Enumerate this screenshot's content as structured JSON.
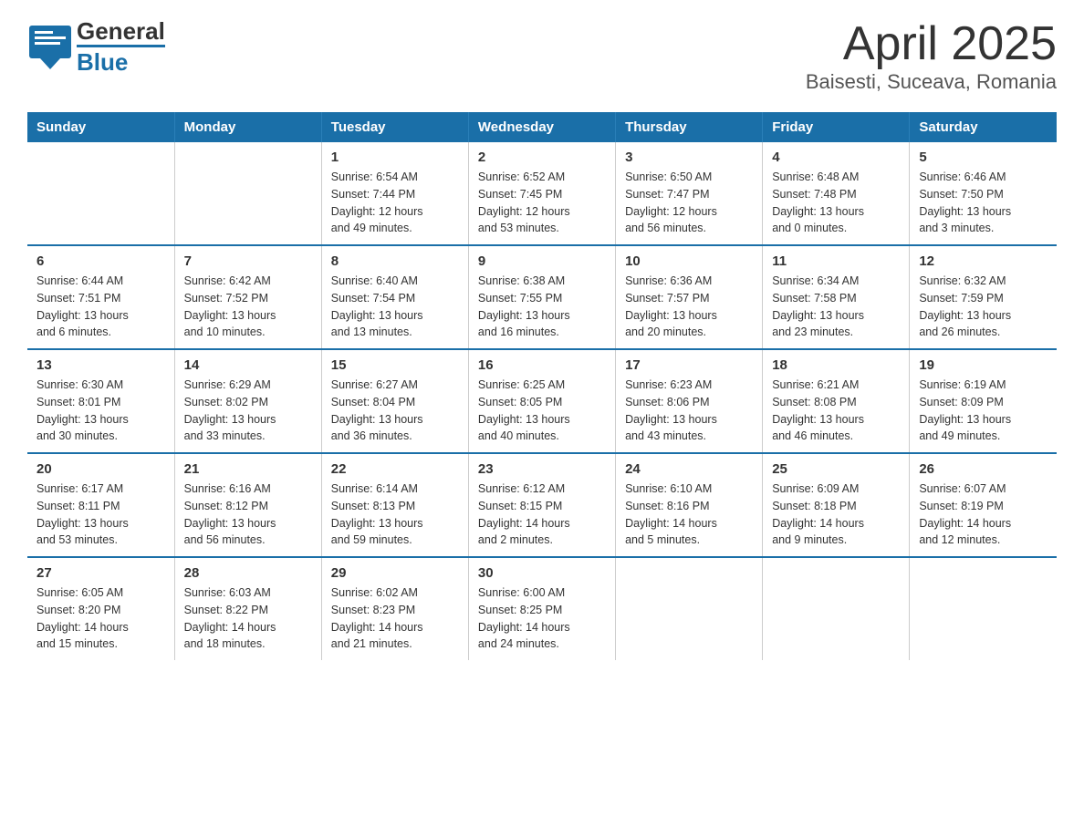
{
  "logo": {
    "text_general": "General",
    "text_blue": "Blue"
  },
  "title": "April 2025",
  "subtitle": "Baisesti, Suceava, Romania",
  "days_of_week": [
    "Sunday",
    "Monday",
    "Tuesday",
    "Wednesday",
    "Thursday",
    "Friday",
    "Saturday"
  ],
  "weeks": [
    [
      {
        "day": "",
        "info": ""
      },
      {
        "day": "",
        "info": ""
      },
      {
        "day": "1",
        "info": "Sunrise: 6:54 AM\nSunset: 7:44 PM\nDaylight: 12 hours\nand 49 minutes."
      },
      {
        "day": "2",
        "info": "Sunrise: 6:52 AM\nSunset: 7:45 PM\nDaylight: 12 hours\nand 53 minutes."
      },
      {
        "day": "3",
        "info": "Sunrise: 6:50 AM\nSunset: 7:47 PM\nDaylight: 12 hours\nand 56 minutes."
      },
      {
        "day": "4",
        "info": "Sunrise: 6:48 AM\nSunset: 7:48 PM\nDaylight: 13 hours\nand 0 minutes."
      },
      {
        "day": "5",
        "info": "Sunrise: 6:46 AM\nSunset: 7:50 PM\nDaylight: 13 hours\nand 3 minutes."
      }
    ],
    [
      {
        "day": "6",
        "info": "Sunrise: 6:44 AM\nSunset: 7:51 PM\nDaylight: 13 hours\nand 6 minutes."
      },
      {
        "day": "7",
        "info": "Sunrise: 6:42 AM\nSunset: 7:52 PM\nDaylight: 13 hours\nand 10 minutes."
      },
      {
        "day": "8",
        "info": "Sunrise: 6:40 AM\nSunset: 7:54 PM\nDaylight: 13 hours\nand 13 minutes."
      },
      {
        "day": "9",
        "info": "Sunrise: 6:38 AM\nSunset: 7:55 PM\nDaylight: 13 hours\nand 16 minutes."
      },
      {
        "day": "10",
        "info": "Sunrise: 6:36 AM\nSunset: 7:57 PM\nDaylight: 13 hours\nand 20 minutes."
      },
      {
        "day": "11",
        "info": "Sunrise: 6:34 AM\nSunset: 7:58 PM\nDaylight: 13 hours\nand 23 minutes."
      },
      {
        "day": "12",
        "info": "Sunrise: 6:32 AM\nSunset: 7:59 PM\nDaylight: 13 hours\nand 26 minutes."
      }
    ],
    [
      {
        "day": "13",
        "info": "Sunrise: 6:30 AM\nSunset: 8:01 PM\nDaylight: 13 hours\nand 30 minutes."
      },
      {
        "day": "14",
        "info": "Sunrise: 6:29 AM\nSunset: 8:02 PM\nDaylight: 13 hours\nand 33 minutes."
      },
      {
        "day": "15",
        "info": "Sunrise: 6:27 AM\nSunset: 8:04 PM\nDaylight: 13 hours\nand 36 minutes."
      },
      {
        "day": "16",
        "info": "Sunrise: 6:25 AM\nSunset: 8:05 PM\nDaylight: 13 hours\nand 40 minutes."
      },
      {
        "day": "17",
        "info": "Sunrise: 6:23 AM\nSunset: 8:06 PM\nDaylight: 13 hours\nand 43 minutes."
      },
      {
        "day": "18",
        "info": "Sunrise: 6:21 AM\nSunset: 8:08 PM\nDaylight: 13 hours\nand 46 minutes."
      },
      {
        "day": "19",
        "info": "Sunrise: 6:19 AM\nSunset: 8:09 PM\nDaylight: 13 hours\nand 49 minutes."
      }
    ],
    [
      {
        "day": "20",
        "info": "Sunrise: 6:17 AM\nSunset: 8:11 PM\nDaylight: 13 hours\nand 53 minutes."
      },
      {
        "day": "21",
        "info": "Sunrise: 6:16 AM\nSunset: 8:12 PM\nDaylight: 13 hours\nand 56 minutes."
      },
      {
        "day": "22",
        "info": "Sunrise: 6:14 AM\nSunset: 8:13 PM\nDaylight: 13 hours\nand 59 minutes."
      },
      {
        "day": "23",
        "info": "Sunrise: 6:12 AM\nSunset: 8:15 PM\nDaylight: 14 hours\nand 2 minutes."
      },
      {
        "day": "24",
        "info": "Sunrise: 6:10 AM\nSunset: 8:16 PM\nDaylight: 14 hours\nand 5 minutes."
      },
      {
        "day": "25",
        "info": "Sunrise: 6:09 AM\nSunset: 8:18 PM\nDaylight: 14 hours\nand 9 minutes."
      },
      {
        "day": "26",
        "info": "Sunrise: 6:07 AM\nSunset: 8:19 PM\nDaylight: 14 hours\nand 12 minutes."
      }
    ],
    [
      {
        "day": "27",
        "info": "Sunrise: 6:05 AM\nSunset: 8:20 PM\nDaylight: 14 hours\nand 15 minutes."
      },
      {
        "day": "28",
        "info": "Sunrise: 6:03 AM\nSunset: 8:22 PM\nDaylight: 14 hours\nand 18 minutes."
      },
      {
        "day": "29",
        "info": "Sunrise: 6:02 AM\nSunset: 8:23 PM\nDaylight: 14 hours\nand 21 minutes."
      },
      {
        "day": "30",
        "info": "Sunrise: 6:00 AM\nSunset: 8:25 PM\nDaylight: 14 hours\nand 24 minutes."
      },
      {
        "day": "",
        "info": ""
      },
      {
        "day": "",
        "info": ""
      },
      {
        "day": "",
        "info": ""
      }
    ]
  ]
}
